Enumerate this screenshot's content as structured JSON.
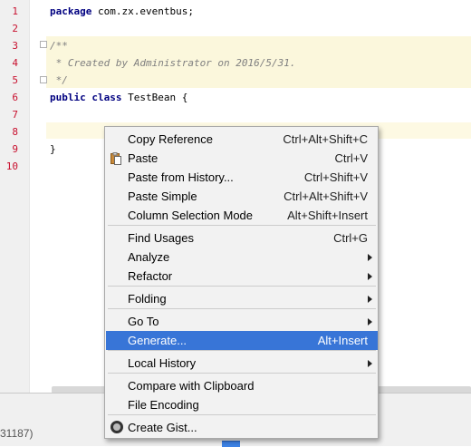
{
  "editor": {
    "line_numbers": [
      "1",
      "2",
      "3",
      "4",
      "5",
      "6",
      "7",
      "8",
      "9",
      "10"
    ],
    "lines": [
      {
        "kw": "package",
        "rest": " com.zx.eventbus;"
      },
      {
        "text": ""
      },
      {
        "cm": "/**"
      },
      {
        "cm": " * Created by Administrator on 2016/5/31."
      },
      {
        "cm": " */"
      },
      {
        "kw": "public class",
        "rest": " TestBean {"
      },
      {
        "text": ""
      },
      {
        "text": ""
      },
      {
        "text": "}"
      },
      {
        "text": ""
      }
    ]
  },
  "status": {
    "text": "31187)"
  },
  "context_menu": {
    "items": [
      {
        "label": "Copy Reference",
        "shortcut": "Ctrl+Alt+Shift+C"
      },
      {
        "label": "Paste",
        "shortcut": "Ctrl+V",
        "icon": "paste-icon"
      },
      {
        "label": "Paste from History...",
        "shortcut": "Ctrl+Shift+V"
      },
      {
        "label": "Paste Simple",
        "shortcut": "Ctrl+Alt+Shift+V"
      },
      {
        "label": "Column Selection Mode",
        "shortcut": "Alt+Shift+Insert"
      },
      {
        "label": "Find Usages",
        "shortcut": "Ctrl+G"
      },
      {
        "label": "Analyze",
        "submenu": true
      },
      {
        "label": "Refactor",
        "submenu": true
      },
      {
        "label": "Folding",
        "submenu": true
      },
      {
        "label": "Go To",
        "submenu": true
      },
      {
        "label": "Generate...",
        "shortcut": "Alt+Insert",
        "selected": true
      },
      {
        "label": "Local History",
        "submenu": true
      },
      {
        "label": "Compare with Clipboard"
      },
      {
        "label": "File Encoding"
      },
      {
        "label": "Create Gist...",
        "icon": "github-icon"
      }
    ]
  },
  "colors": {
    "selection": "#3875d7",
    "comment_highlight": "#fbf7dc",
    "caret_line": "#fdf9e3",
    "line_number": "#c8102e"
  }
}
